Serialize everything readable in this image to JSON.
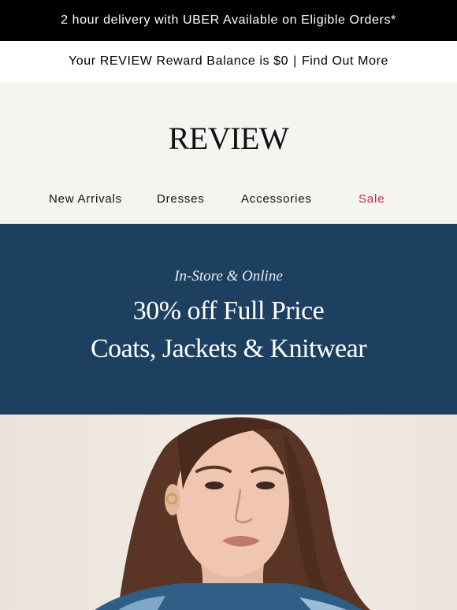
{
  "announcement": {
    "text": "2 hour delivery with UBER Available on Eligible Orders*"
  },
  "reward": {
    "balance_text": "Your REVIEW Reward Balance is $0",
    "separator": "|",
    "link": "Find Out More"
  },
  "brand": {
    "logo": "REVIEW"
  },
  "nav": {
    "items": [
      "New Arrivals",
      "Dresses",
      "Accessories",
      "Sale"
    ]
  },
  "promo": {
    "subtitle": "In-Store & Online",
    "line1": "30% off Full Price",
    "line2": "Coats, Jackets & Knitwear"
  },
  "colors": {
    "promo_bg": "#1e4060",
    "sale": "#c3274f",
    "header_bg": "#f6f4f1"
  }
}
